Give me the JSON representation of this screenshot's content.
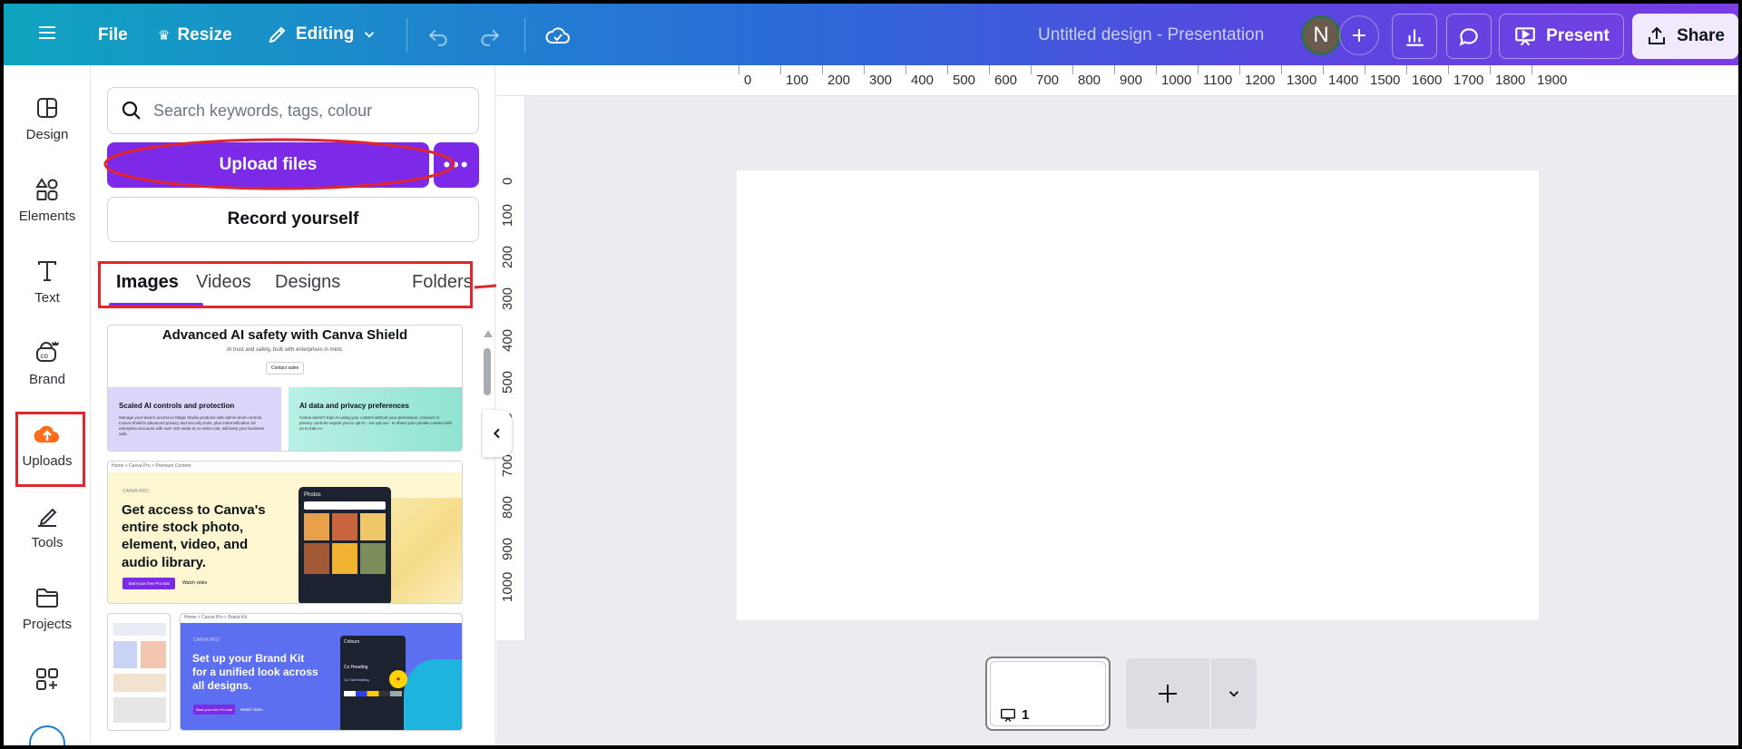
{
  "topbar": {
    "file_label": "File",
    "resize_label": "Resize",
    "editing_label": "Editing",
    "document_title": "Untitled design - Presentation",
    "avatar_initial": "N",
    "present_label": "Present",
    "share_label": "Share",
    "icons": [
      "menu-icon",
      "crown-icon",
      "pencil-icon",
      "chevron-down-icon",
      "undo-icon",
      "redo-icon",
      "cloud-check-icon",
      "plus-icon",
      "bar-chart-icon",
      "comment-icon",
      "present-icon",
      "share-icon"
    ]
  },
  "rail": {
    "items": [
      {
        "label": "Design",
        "icon": "design-icon"
      },
      {
        "label": "Elements",
        "icon": "elements-icon"
      },
      {
        "label": "Text",
        "icon": "text-icon"
      },
      {
        "label": "Brand",
        "icon": "brand-icon"
      },
      {
        "label": "Uploads",
        "icon": "upload-cloud-icon"
      },
      {
        "label": "Tools",
        "icon": "tools-icon"
      },
      {
        "label": "Projects",
        "icon": "folder-icon"
      },
      {
        "label": "",
        "icon": "apps-icon"
      }
    ]
  },
  "panel": {
    "search_placeholder": "Search keywords, tags, colour",
    "upload_label": "Upload files",
    "record_label": "Record yourself",
    "tabs": [
      "Images",
      "Videos",
      "Designs",
      "Folders"
    ],
    "active_tab": "Images",
    "thumbnails": [
      {
        "title": "Advanced AI safety with Canva Shield",
        "subtitle": "AI trust and safety, built with enterprises in mind.",
        "cta": "Contact sales",
        "card_left_title": "Scaled AI controls and protection",
        "card_left_text": "Manage your team's access to Magic Studio products with admin-level controls. Canva Shield's advanced privacy and security tools, plus indemnification for enterprise accounts with over 100 seats at no extra cost, will keep your business safe.",
        "card_right_title": "AI data and privacy preferences",
        "card_right_text": "Canva doesn't train AI using your content without your permission. Canva's AI privacy controls require you to opt-in - not opt out - to share your private content with us to train AI."
      },
      {
        "breadcrumb": [
          "Home",
          "Canva Pro",
          "Premium Content"
        ],
        "eyebrow": "CANVA PRO",
        "headline": "Get access to Canva's entire stock photo, element, video, and audio library.",
        "cta_primary": "Start your free Pro trial",
        "cta_secondary": "Watch video",
        "panel_title": "Photos"
      },
      {
        "breadcrumb": [
          "Home",
          "Canva Pro",
          "Brand Kit"
        ],
        "eyebrow": "CANVA PRO",
        "headline": "Set up your Brand Kit for a unified look across all designs.",
        "cta_primary": "Start your free Pro trial",
        "cta_secondary": "Watch video",
        "panel_label": "Colours",
        "panel_heading": "Co Heading",
        "panel_sub": "Co Subheading"
      }
    ]
  },
  "ruler": {
    "top": [
      "0",
      "100",
      "200",
      "300",
      "400",
      "500",
      "600",
      "700",
      "800",
      "900",
      "1000",
      "1100",
      "1200",
      "1300",
      "1400",
      "1500",
      "1600",
      "1700",
      "1800",
      "1900"
    ],
    "left": [
      "0",
      "100",
      "200",
      "300",
      "400",
      "500",
      "600",
      "700",
      "800",
      "900",
      "1000"
    ]
  },
  "pages": {
    "current_page_number": "1"
  },
  "colors": {
    "accent": "#7d2ae8",
    "annotation": "#e3262d"
  }
}
